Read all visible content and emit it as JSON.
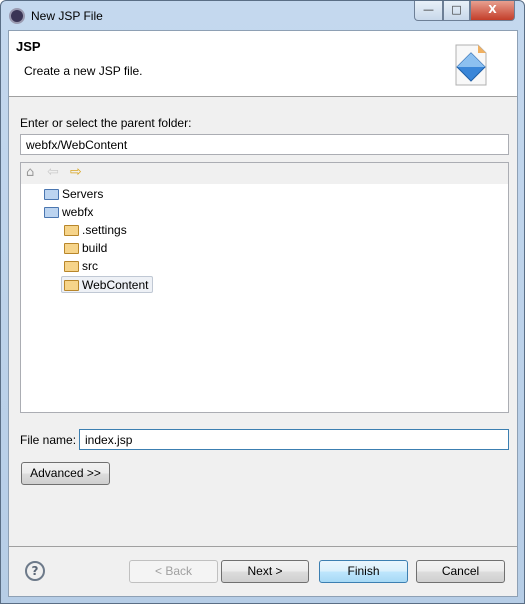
{
  "window": {
    "title": "New JSP File",
    "minimize": "—",
    "maximize": "□",
    "close": "X"
  },
  "header": {
    "title": "JSP",
    "description": "Create a new JSP file."
  },
  "parent_folder": {
    "label": "Enter or select the parent folder:",
    "value": "webfx/WebContent"
  },
  "tree": {
    "items": [
      {
        "label": "Servers",
        "icon": "project-folder-icon",
        "level": 0
      },
      {
        "label": "webfx",
        "icon": "web-project-icon",
        "level": 0
      },
      {
        "label": ".settings",
        "icon": "folder-icon",
        "level": 1
      },
      {
        "label": "build",
        "icon": "folder-icon",
        "level": 1
      },
      {
        "label": "src",
        "icon": "folder-icon",
        "level": 1
      },
      {
        "label": "WebContent",
        "icon": "folder-icon",
        "level": 1,
        "selected": true
      }
    ]
  },
  "file_name": {
    "label": "File name:",
    "value": "index.jsp"
  },
  "advanced_label": "Advanced >>",
  "buttons": {
    "back": "< Back",
    "next": "Next >",
    "finish": "Finish",
    "cancel": "Cancel"
  },
  "help": "?"
}
